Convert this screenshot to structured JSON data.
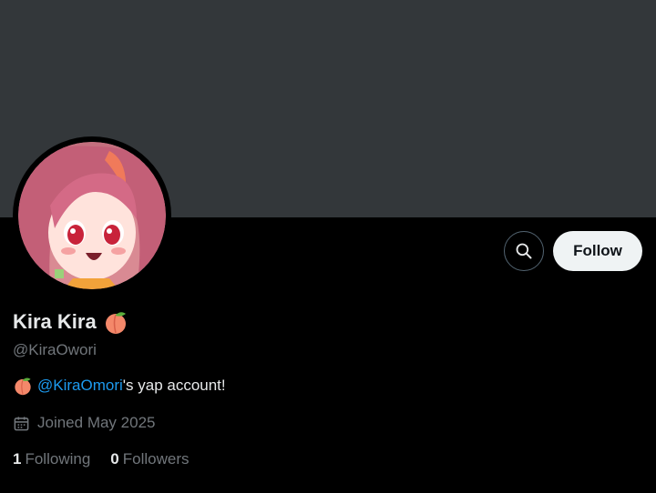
{
  "profile": {
    "display_name": "Kira Kira",
    "handle": "@KiraOwori",
    "bio_mention": "@KiraOmori",
    "bio_suffix": "'s yap account!",
    "joined": "Joined May 2025"
  },
  "actions": {
    "follow_label": "Follow",
    "search_icon": "search-icon"
  },
  "stats": {
    "following_count": "1",
    "following_label": "Following",
    "followers_count": "0",
    "followers_label": "Followers"
  },
  "colors": {
    "banner": "#33373a",
    "background": "#000000",
    "link": "#1d9bf0",
    "muted": "#71767b",
    "follow_button_bg": "#eff3f4"
  }
}
